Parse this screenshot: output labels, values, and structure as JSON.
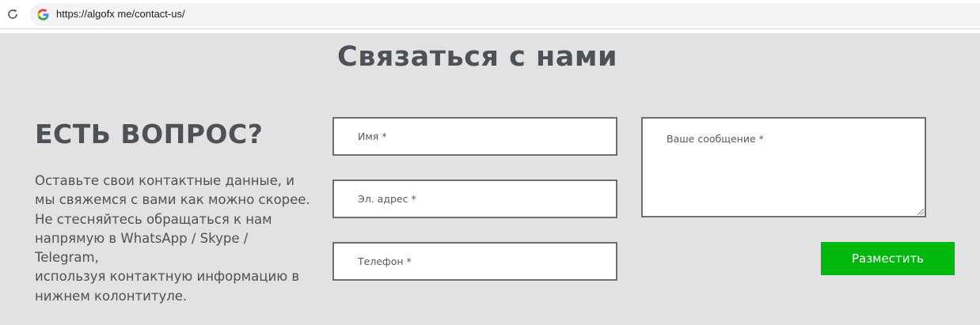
{
  "browser": {
    "url": "https://algofx me/contact-us/",
    "reload_icon": "reload-icon",
    "site_icon": "google-g-icon"
  },
  "page": {
    "title": "Связаться с нами",
    "heading": "ЕСТЬ ВОПРОС?",
    "intro_lines": [
      "Оставьте свои контактные данные, и",
      "мы свяжемся с вами как можно скорее.",
      "Не стесняйтесь обращаться к нам",
      "напрямую в WhatsApp / Skype /",
      "Telegram,",
      "используя контактную информацию в",
      "нижнем колонтитуле."
    ]
  },
  "form": {
    "name_placeholder": "Имя *",
    "name_value": "",
    "email_placeholder": "Эл. адрес *",
    "email_value": "",
    "phone_placeholder": "Телефон *",
    "phone_value": "",
    "message_placeholder": "Ваше сообщение *",
    "message_value": "",
    "submit_label": "Разместить"
  },
  "colors": {
    "page_background": "#e2e2e2",
    "text": "#4c5257",
    "submit_button": "#00b70e",
    "field_border": "#6f6f6f"
  }
}
